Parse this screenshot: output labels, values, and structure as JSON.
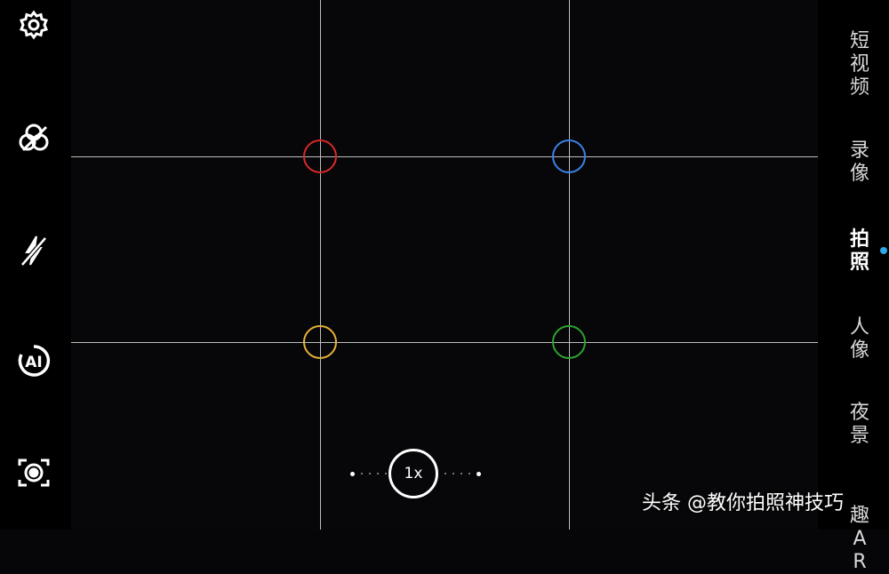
{
  "zoom": {
    "label": "1x"
  },
  "modes": [
    {
      "label": "短视频",
      "active": false
    },
    {
      "label": "录像",
      "active": false
    },
    {
      "label": "拍照",
      "active": true
    },
    {
      "label": "人像",
      "active": false
    },
    {
      "label": "夜景",
      "active": false
    },
    {
      "label": "趣AR",
      "active": false
    }
  ],
  "tools": [
    {
      "icon": "settings-gear-icon"
    },
    {
      "icon": "filter-effects-icon"
    },
    {
      "icon": "flash-off-icon"
    },
    {
      "icon": "ai-mode-icon"
    },
    {
      "icon": "lens-capture-icon"
    }
  ],
  "focus_rings": [
    {
      "color": "#d8282a"
    },
    {
      "color": "#3a82e6"
    },
    {
      "color": "#e6b13a"
    },
    {
      "color": "#2ea32e"
    }
  ],
  "colors": {
    "grid": "#bdbdbd",
    "active_indicator": "#2fa8e8",
    "background": "#070709"
  },
  "watermark": {
    "text": "头条 @教你拍照神技巧"
  }
}
